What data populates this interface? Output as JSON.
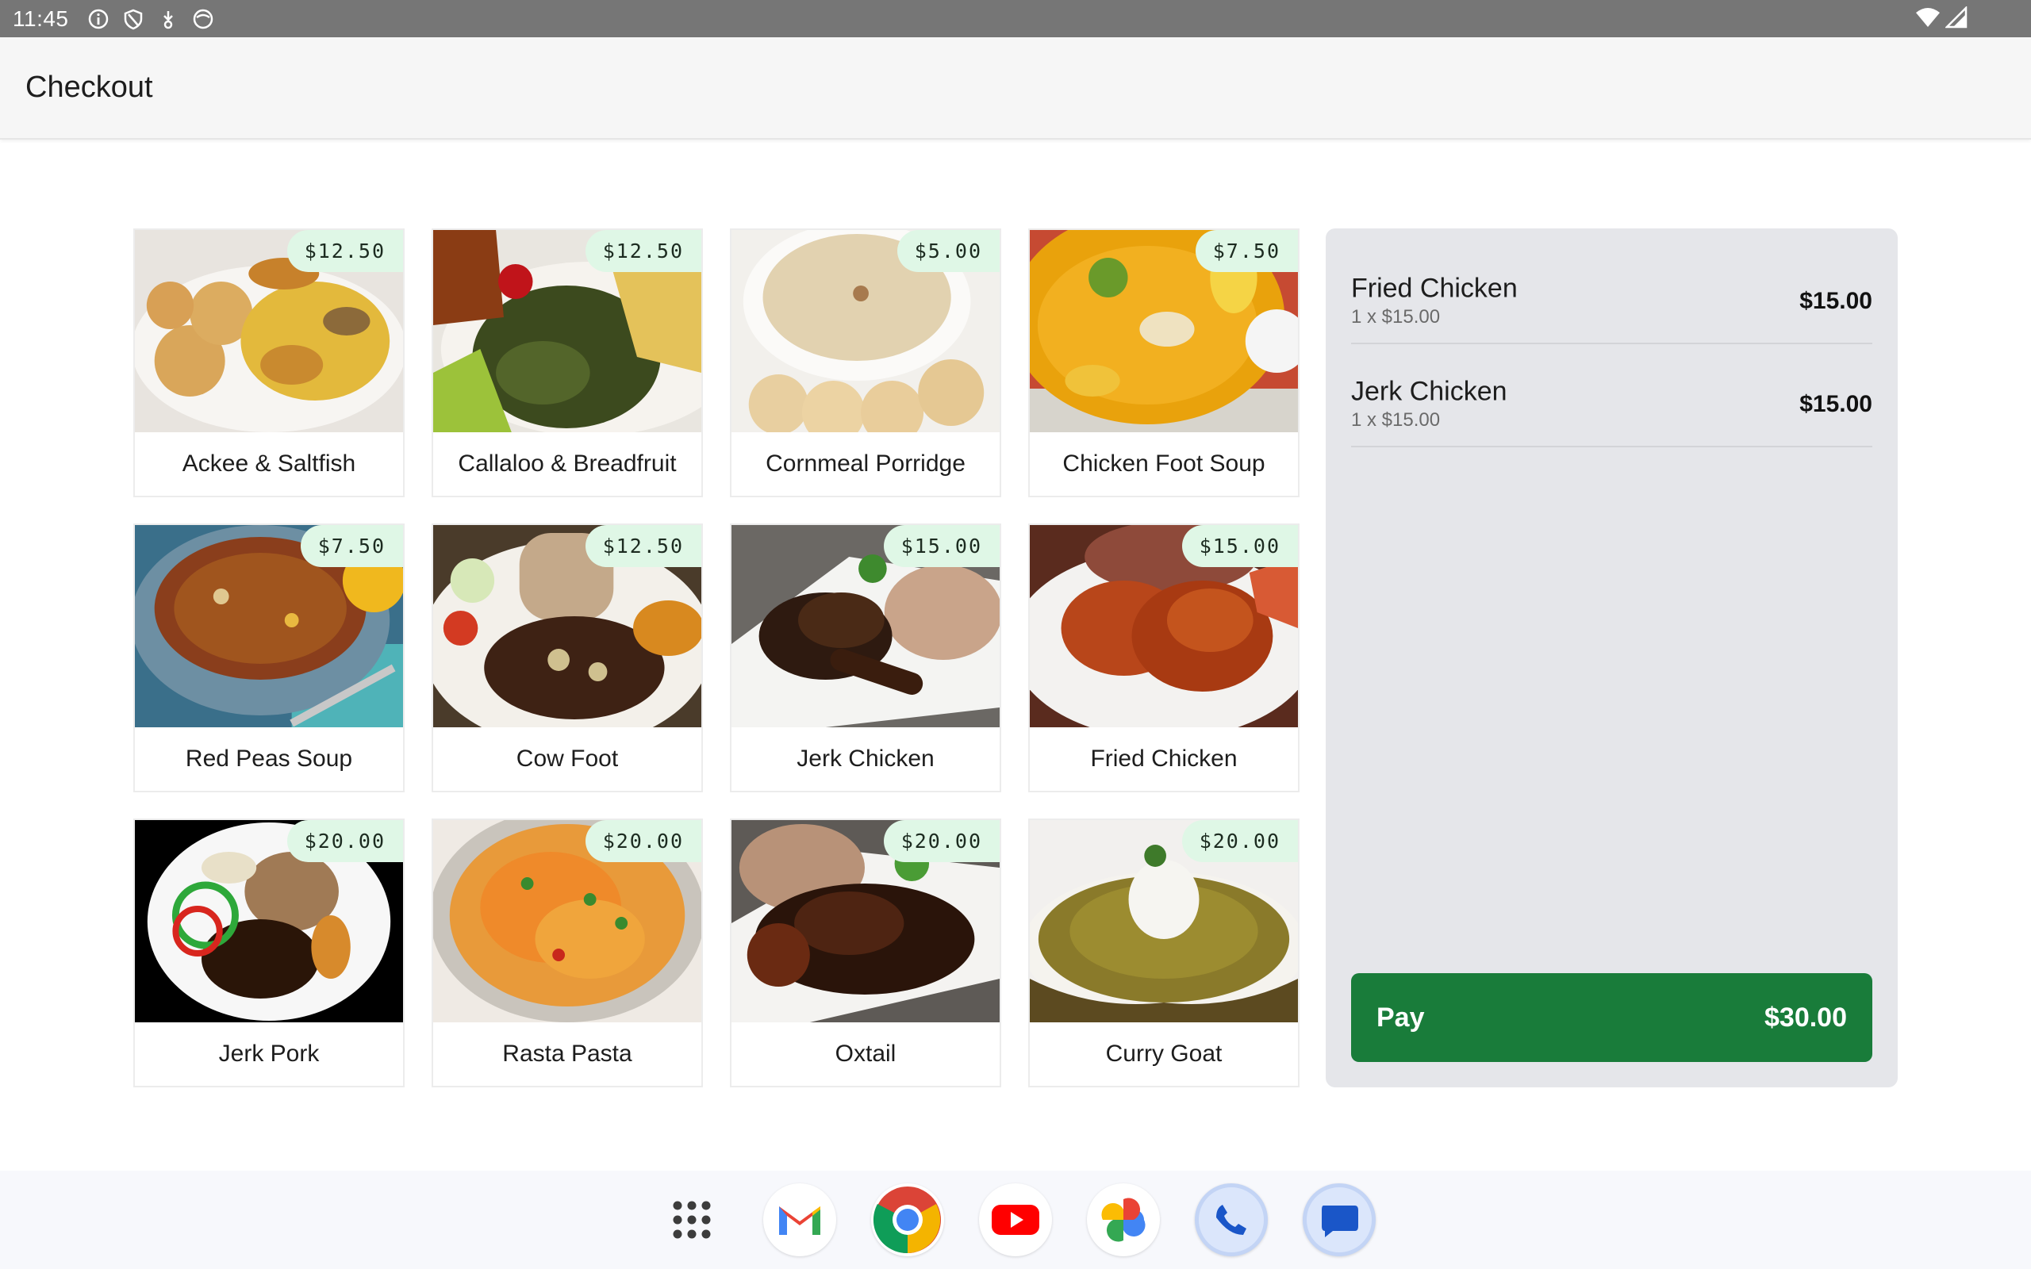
{
  "status_bar": {
    "time": "11:45",
    "icons": [
      "info-icon",
      "shield-icon",
      "download-icon",
      "mask-icon"
    ],
    "right_icons": [
      "wifi-icon",
      "signal-icon"
    ]
  },
  "app_bar": {
    "title": "Checkout"
  },
  "products": [
    {
      "name": "Ackee & Saltfish",
      "price": "$12.50",
      "image": "ackee-saltfish-photo"
    },
    {
      "name": "Callaloo & Breadfruit",
      "price": "$12.50",
      "image": "callaloo-breadfruit-photo"
    },
    {
      "name": "Cornmeal Porridge",
      "price": "$5.00",
      "image": "cornmeal-porridge-photo"
    },
    {
      "name": "Chicken Foot Soup",
      "price": "$7.50",
      "image": "chicken-foot-soup-photo"
    },
    {
      "name": "Red Peas Soup",
      "price": "$7.50",
      "image": "red-peas-soup-photo"
    },
    {
      "name": "Cow Foot",
      "price": "$12.50",
      "image": "cow-foot-photo"
    },
    {
      "name": "Jerk Chicken",
      "price": "$15.00",
      "image": "jerk-chicken-photo"
    },
    {
      "name": "Fried Chicken",
      "price": "$15.00",
      "image": "fried-chicken-photo"
    },
    {
      "name": "Jerk Pork",
      "price": "$20.00",
      "image": "jerk-pork-photo"
    },
    {
      "name": "Rasta Pasta",
      "price": "$20.00",
      "image": "rasta-pasta-photo"
    },
    {
      "name": "Oxtail",
      "price": "$20.00",
      "image": "oxtail-photo"
    },
    {
      "name": "Curry Goat",
      "price": "$20.00",
      "image": "curry-goat-photo"
    }
  ],
  "cart": {
    "items": [
      {
        "name": "Fried Chicken",
        "qty_line": "1 x $15.00",
        "total": "$15.00"
      },
      {
        "name": "Jerk Chicken",
        "qty_line": "1 x $15.00",
        "total": "$15.00"
      }
    ],
    "pay_label": "Pay",
    "pay_total": "$30.00"
  },
  "dock": {
    "apps": [
      "app-drawer-icon",
      "gmail-icon",
      "chrome-icon",
      "youtube-icon",
      "photos-icon",
      "phone-icon",
      "messages-icon"
    ]
  },
  "colors": {
    "status_bar": "#767676",
    "price_badge": "#dff7e6",
    "cart_bg": "#e5e6ea",
    "pay_button": "#197c3a"
  }
}
